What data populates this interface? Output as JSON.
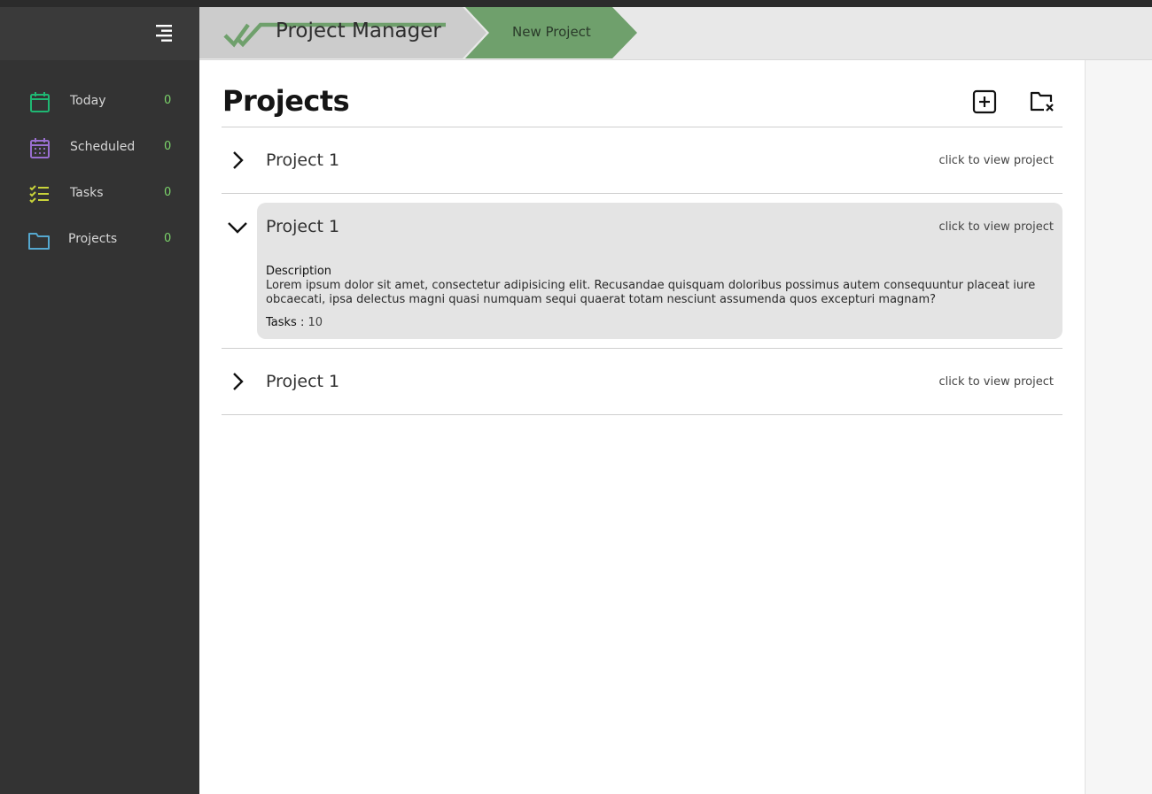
{
  "app": {
    "brand": "Project Manager",
    "new_project": "New Project"
  },
  "colors": {
    "sidebar_bg": "#333333",
    "accent_green": "#6fa06c",
    "count_green": "#7bd36a",
    "today_icon": "#1fb873",
    "scheduled_icon": "#9a6fd0",
    "tasks_icon": "#c9d43a",
    "projects_icon": "#55a8cf"
  },
  "sidebar": {
    "items": [
      {
        "label": "Today",
        "count": "0",
        "icon": "calendar-icon"
      },
      {
        "label": "Scheduled",
        "count": "0",
        "icon": "calendar-grid-icon"
      },
      {
        "label": "Tasks",
        "count": "0",
        "icon": "checklist-icon"
      },
      {
        "label": "Projects",
        "count": "0",
        "icon": "folder-icon"
      }
    ]
  },
  "main": {
    "title": "Projects",
    "add_icon": "add-square-icon",
    "delete_icon": "folder-remove-icon",
    "projects": [
      {
        "name": "Project 1",
        "link": "click to view project",
        "expanded": false
      },
      {
        "name": "Project 1",
        "link": "click to view project",
        "expanded": true,
        "description_label": "Description",
        "description": "Lorem ipsum dolor sit amet, consectetur adipisicing elit. Recusandae quisquam doloribus possimus autem consequuntur placeat iure obcaecati, ipsa delectus magni quasi numquam sequi quaerat totam nesciunt assumenda quos excepturi magnam?",
        "tasks_label": "Tasks :",
        "tasks_count": "10"
      },
      {
        "name": "Project 1",
        "link": "click to view project",
        "expanded": false
      }
    ]
  }
}
